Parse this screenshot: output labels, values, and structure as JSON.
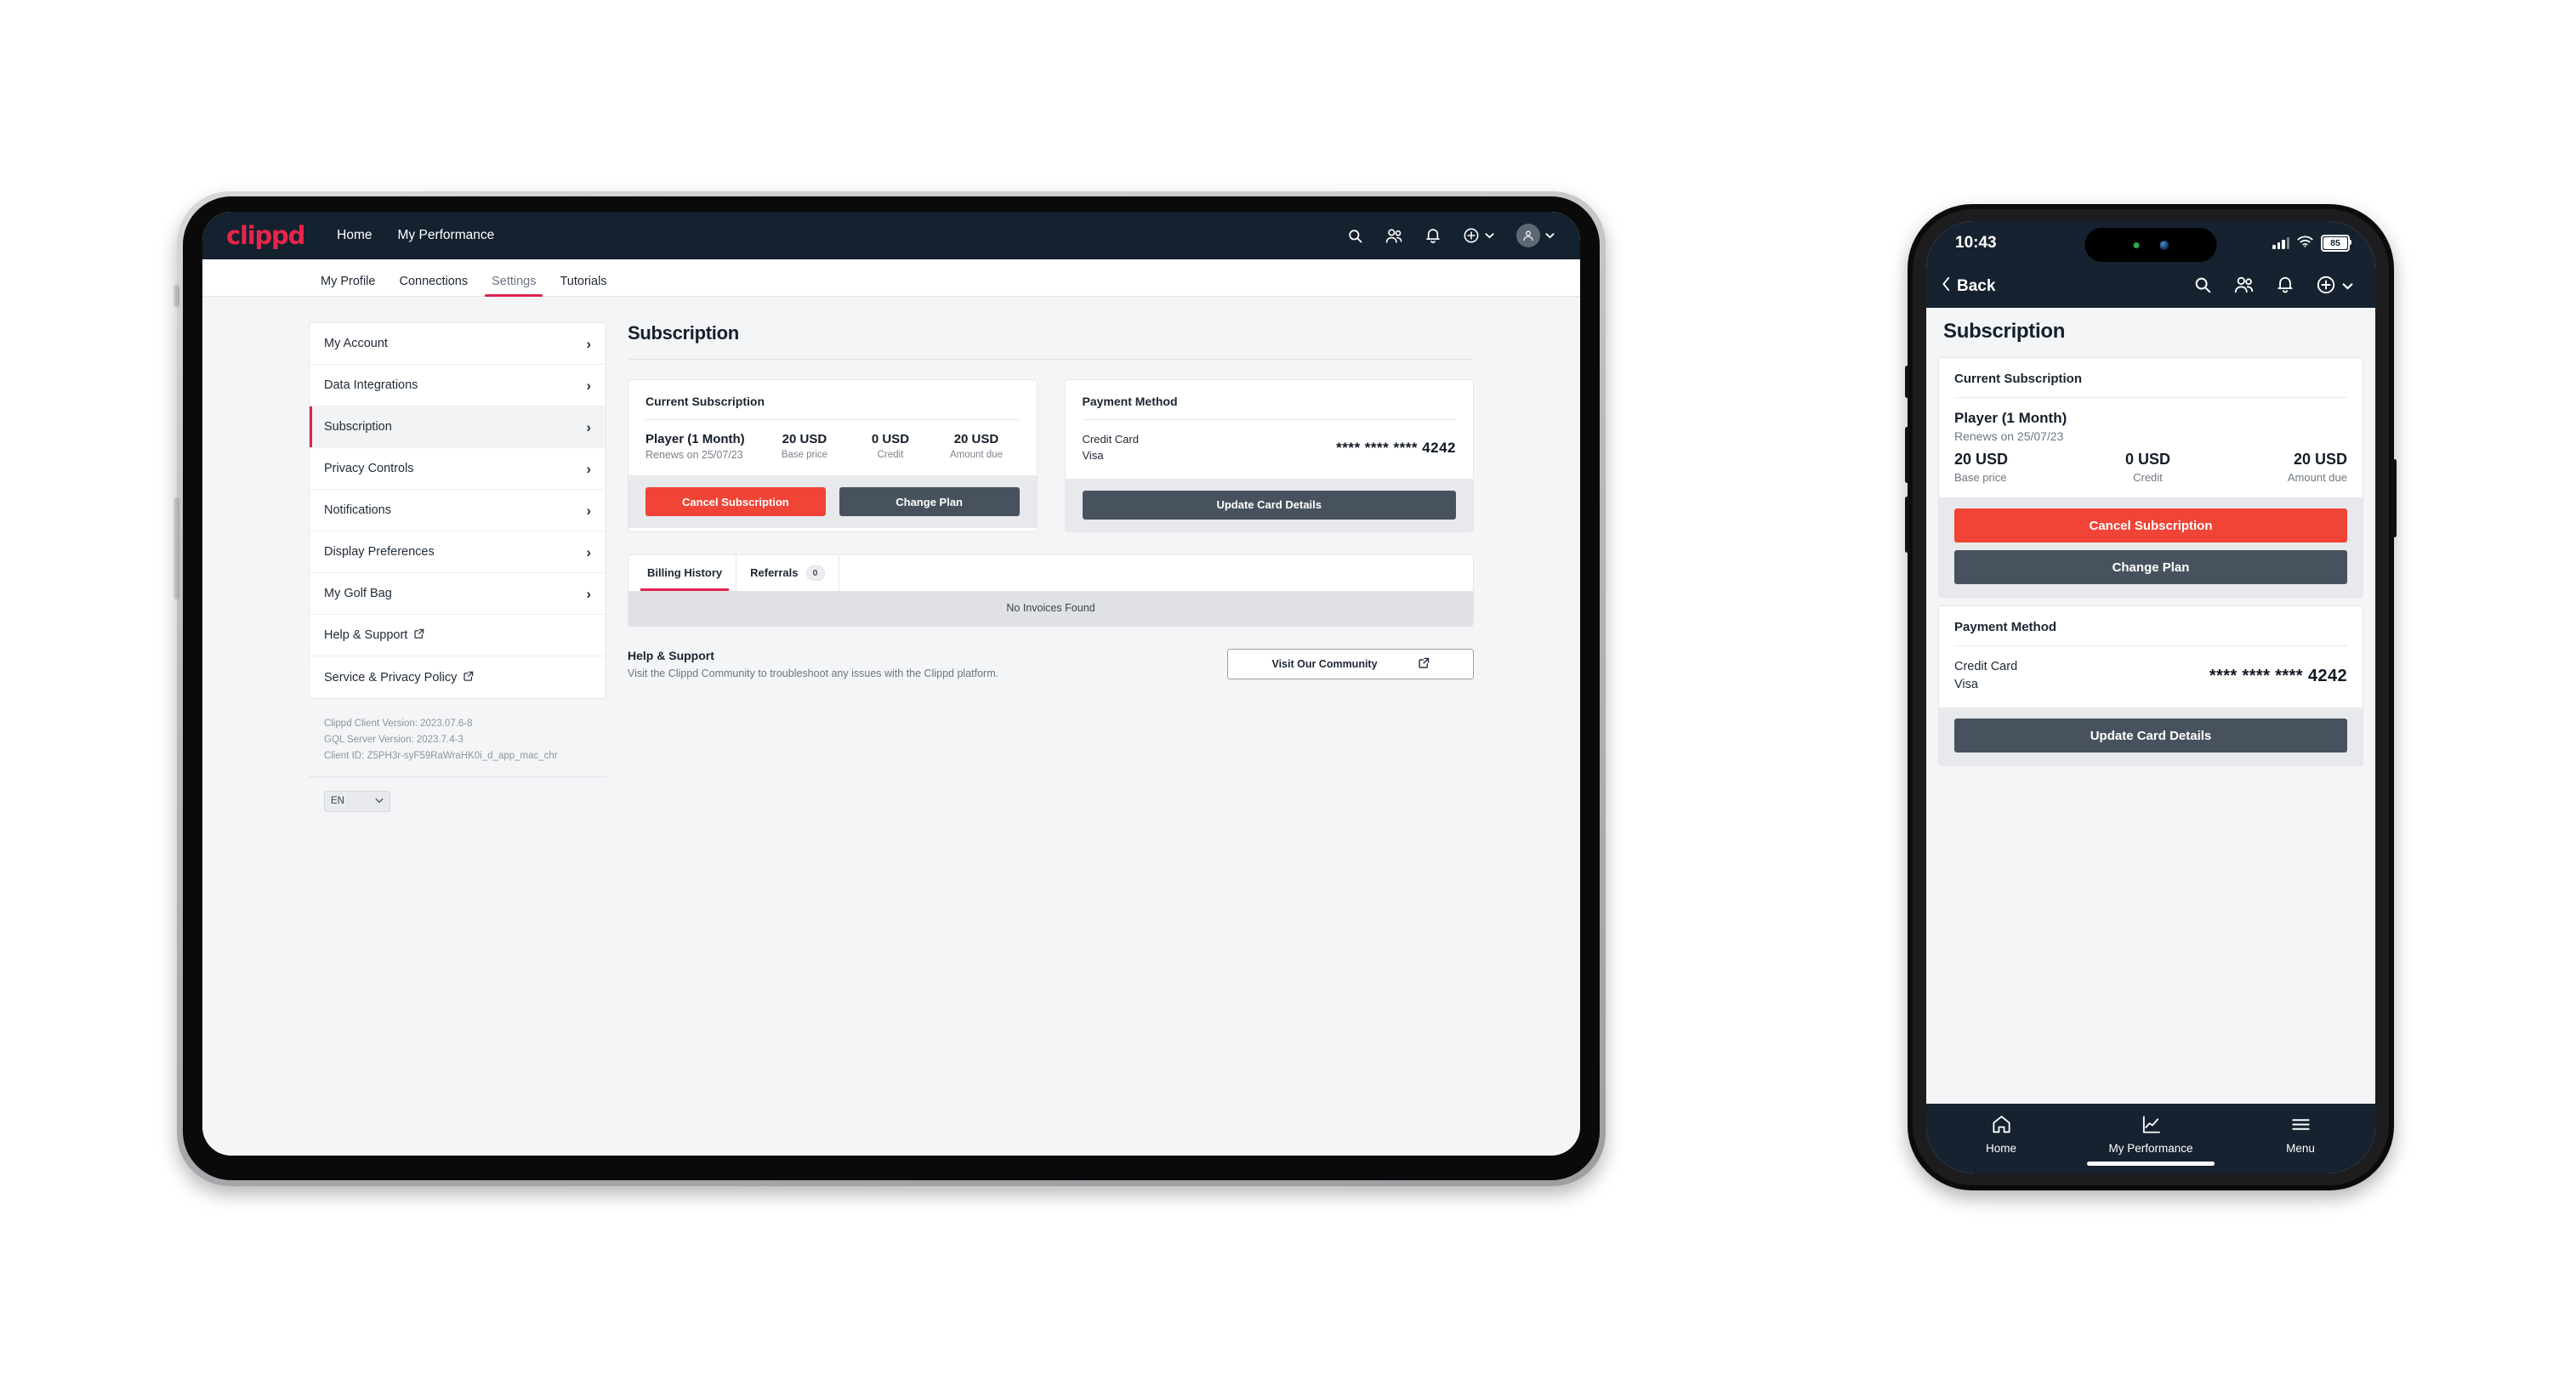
{
  "brand": {
    "logo_text": "clippd",
    "accent_red": "#e0234e",
    "danger_red": "#ef4436",
    "dark_slate": "#16222f",
    "button_dark": "#48525e"
  },
  "tablet": {
    "topbar": {
      "logo": "clippd",
      "nav": [
        "Home",
        "My Performance"
      ],
      "icons": [
        "search-icon",
        "people-icon",
        "bell-icon",
        "plus-circle-icon",
        "avatar-icon"
      ]
    },
    "tabs": [
      {
        "label": "My Profile",
        "active": false
      },
      {
        "label": "Connections",
        "active": false
      },
      {
        "label": "Settings",
        "active": true
      },
      {
        "label": "Tutorials",
        "active": false
      }
    ],
    "sidebar": {
      "items": [
        {
          "label": "My Account",
          "type": "chevron",
          "selected": false
        },
        {
          "label": "Data Integrations",
          "type": "chevron",
          "selected": false
        },
        {
          "label": "Subscription",
          "type": "chevron",
          "selected": true
        },
        {
          "label": "Privacy Controls",
          "type": "chevron",
          "selected": false
        },
        {
          "label": "Notifications",
          "type": "chevron",
          "selected": false
        },
        {
          "label": "Display Preferences",
          "type": "chevron",
          "selected": false
        },
        {
          "label": "My Golf Bag",
          "type": "chevron",
          "selected": false
        },
        {
          "label": "Help & Support",
          "type": "external",
          "selected": false
        },
        {
          "label": "Service & Privacy Policy",
          "type": "external",
          "selected": false
        }
      ],
      "versions": {
        "client": "Clippd Client Version: 2023.07.6-8",
        "server": "GQL Server Version: 2023.7.4-3",
        "client_id": "Client ID: Z5PH3r-syF59RaWraHK0i_d_app_mac_chr"
      },
      "language": "EN"
    },
    "main": {
      "page_title": "Subscription",
      "current_subscription": {
        "card_title": "Current Subscription",
        "plan_name": "Player (1 Month)",
        "renews": "Renews on 25/07/23",
        "amounts": [
          {
            "value": "20 USD",
            "label": "Base price"
          },
          {
            "value": "0 USD",
            "label": "Credit"
          },
          {
            "value": "20 USD",
            "label": "Amount due"
          }
        ],
        "cancel_label": "Cancel Subscription",
        "change_label": "Change Plan"
      },
      "payment_method": {
        "card_title": "Payment Method",
        "type": "Credit Card",
        "brand": "Visa",
        "number": "**** **** **** 4242",
        "update_label": "Update Card Details"
      },
      "history": {
        "tabs": [
          {
            "label": "Billing History",
            "badge": "",
            "active": true
          },
          {
            "label": "Referrals",
            "badge": "0",
            "active": false
          }
        ],
        "empty_text": "No Invoices Found"
      },
      "help": {
        "title": "Help & Support",
        "description": "Visit the Clippd Community to troubleshoot any issues with the Clippd platform.",
        "button_label": "Visit Our Community"
      }
    }
  },
  "phone": {
    "status": {
      "time": "10:43",
      "battery": "85"
    },
    "appbar": {
      "back_label": "Back",
      "icons": [
        "search-icon",
        "people-icon",
        "bell-icon",
        "plus-circle-icon",
        "chevron-down-icon"
      ]
    },
    "page_title": "Subscription",
    "current_subscription": {
      "card_title": "Current Subscription",
      "plan_name": "Player (1 Month)",
      "renews": "Renews on 25/07/23",
      "amounts": [
        {
          "value": "20 USD",
          "label": "Base price"
        },
        {
          "value": "0 USD",
          "label": "Credit"
        },
        {
          "value": "20 USD",
          "label": "Amount due"
        }
      ],
      "cancel_label": "Cancel Subscription",
      "change_label": "Change Plan"
    },
    "payment_method": {
      "card_title": "Payment Method",
      "type": "Credit Card",
      "brand": "Visa",
      "number": "**** **** **** 4242",
      "update_label": "Update Card Details"
    },
    "tabbar": [
      {
        "label": "Home",
        "icon": "home-icon"
      },
      {
        "label": "My Performance",
        "icon": "chart-line-icon"
      },
      {
        "label": "Menu",
        "icon": "hamburger-icon"
      }
    ]
  }
}
